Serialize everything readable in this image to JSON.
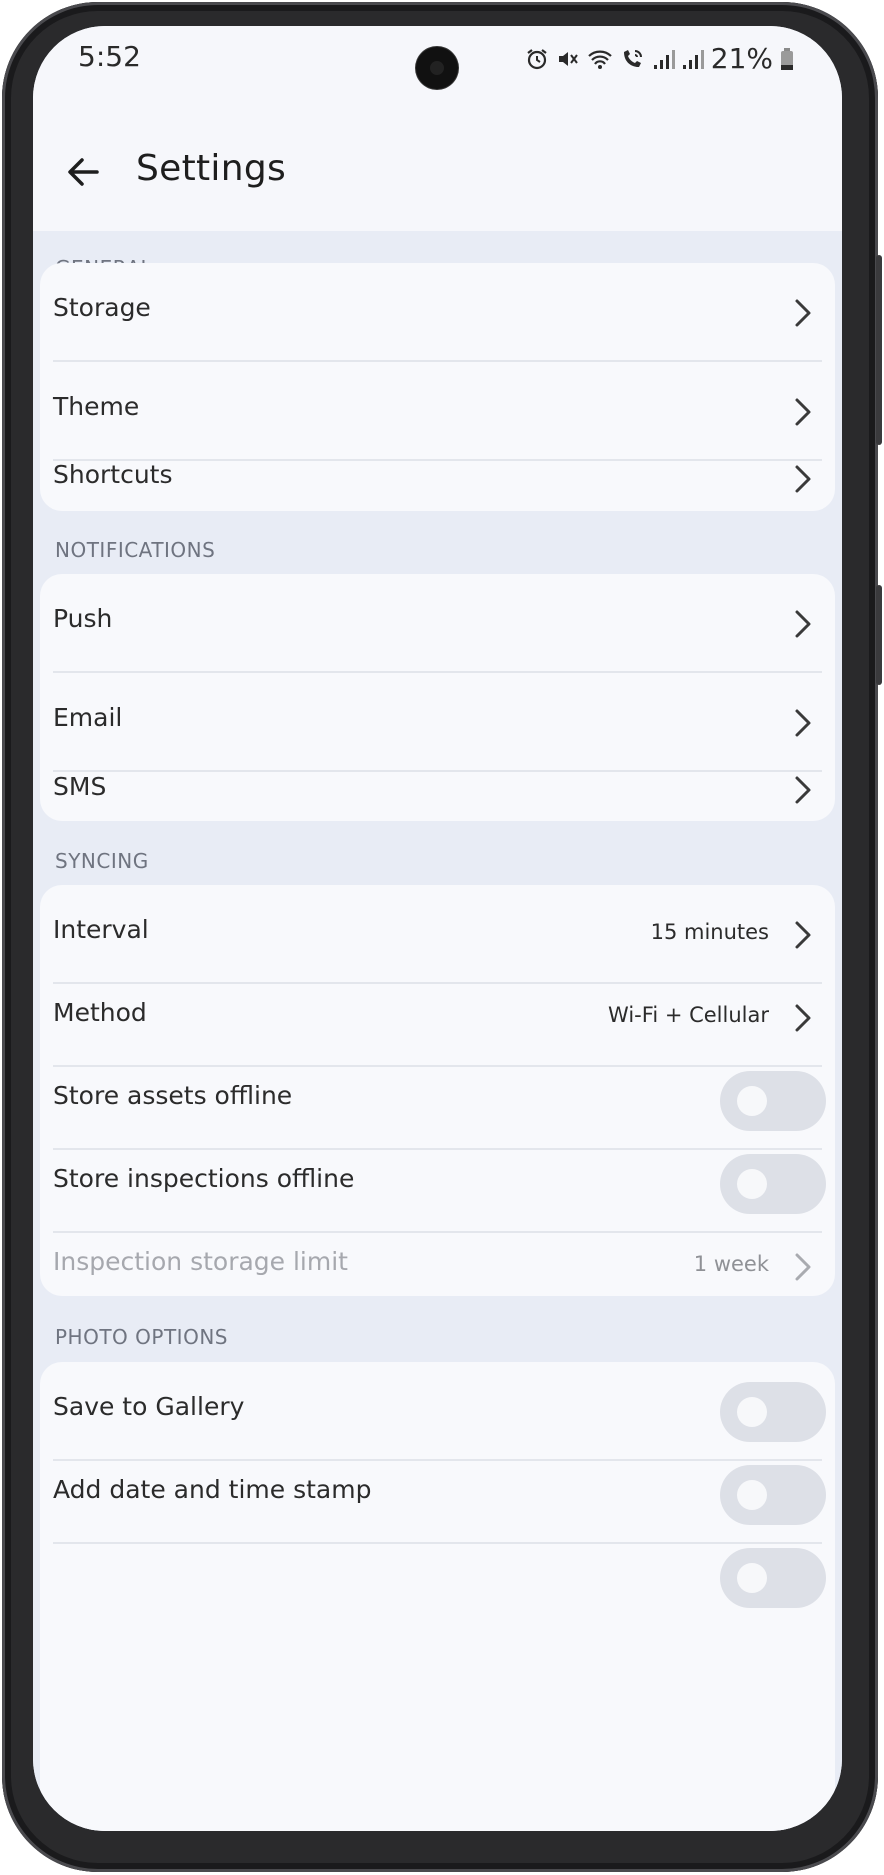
{
  "status_bar": {
    "time": "5:52",
    "battery": "21%",
    "icons": [
      "alarm-icon",
      "mute-icon",
      "wifi-icon",
      "wifi-calling-icon",
      "signal-icon",
      "signal-icon",
      "battery-icon"
    ]
  },
  "app_bar": {
    "title": "Settings",
    "back_icon": "arrow-left-icon"
  },
  "sections": {
    "general": {
      "header": "GENERAL",
      "items": [
        {
          "label": "Storage"
        },
        {
          "label": "Theme"
        },
        {
          "label": "Shortcuts"
        }
      ]
    },
    "notifications": {
      "header": "NOTIFICATIONS",
      "items": [
        {
          "label": "Push"
        },
        {
          "label": "Email"
        },
        {
          "label": "SMS"
        }
      ]
    },
    "syncing": {
      "header": "SYNCING",
      "items": [
        {
          "label": "Interval",
          "value": "15 minutes"
        },
        {
          "label": "Method",
          "value": "Wi-Fi + Cellular"
        },
        {
          "label": "Store assets offline",
          "toggle_on": false
        },
        {
          "label": "Store inspections offline",
          "toggle_on": false
        },
        {
          "label": "Inspection storage limit",
          "value": "1 week",
          "disabled": true
        }
      ]
    },
    "photo_options": {
      "header": "PHOTO OPTIONS",
      "items": [
        {
          "label": "Save to Gallery",
          "toggle_on": false
        },
        {
          "label": "Add date and time stamp",
          "toggle_on": false
        }
      ]
    }
  },
  "colors": {
    "background": "#e8ecf5",
    "card": "#f8f9fc",
    "toggle_off": "#dde0e7",
    "text": "#2b2b2b",
    "section_header": "#6f7480"
  }
}
